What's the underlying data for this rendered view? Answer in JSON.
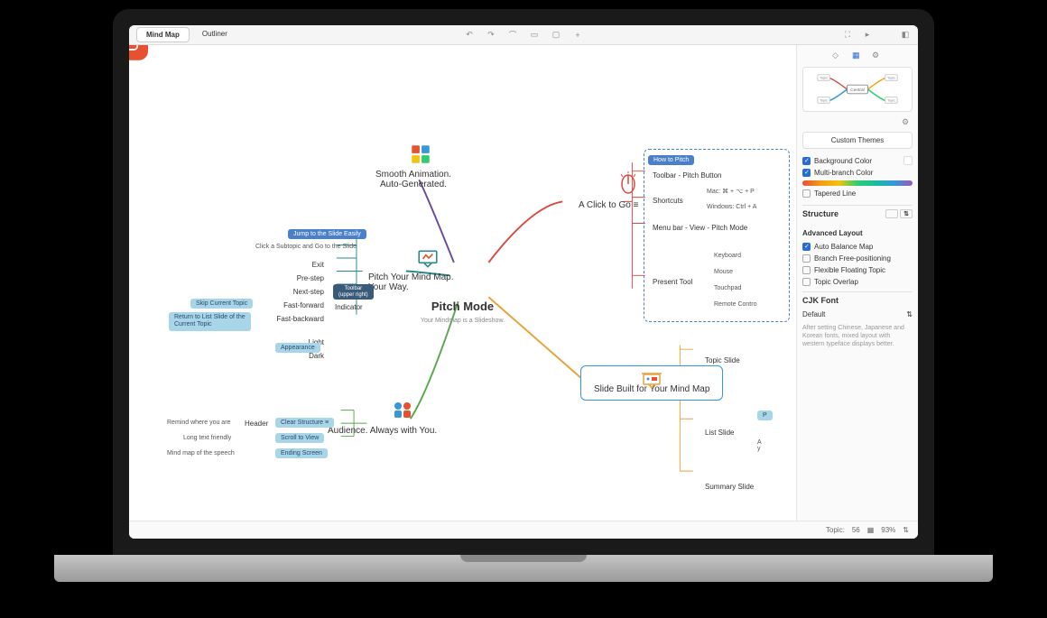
{
  "header": {
    "tabs": [
      "Mind Map",
      "Outliner"
    ],
    "active_tab": "Mind Map"
  },
  "central": {
    "title": "Pitch Mode",
    "subtitle": "Your Mindmap is a Slideshow."
  },
  "branch_top_left": {
    "label": "Smooth Animation.\nAuto-Generated."
  },
  "branch_mid_left": {
    "label": "Pitch Your Mind Map.\nYour Way.",
    "pill": "Jump to the Slide Easily",
    "click_sub": "Click a Subtopic and Go to the Slide",
    "items": [
      "Exit",
      "Pre-step",
      "Next-step",
      "Fast-forward",
      "Fast-backward",
      "Light",
      "Dark"
    ],
    "indicator_label": "Indicator",
    "indicator_tooltip": "Toolbar\n(upper right)",
    "sub_pills": [
      "Skip Current Topic",
      "Return to List Slide of the\nCurrent Topic",
      "Appearance"
    ]
  },
  "branch_bot_left": {
    "label": "Audience. Always with You.",
    "rows": [
      {
        "left": "Remind where you are",
        "mid": "Header",
        "right": "Clear Structure"
      },
      {
        "left": "Long text friendly",
        "mid": "",
        "right": "Scroll to View"
      },
      {
        "left": "Mind map of the speech",
        "mid": "",
        "right": "Ending Screen"
      }
    ]
  },
  "branch_top_right": {
    "label": "A Click to Go",
    "pill": "How to Pitch",
    "rows": [
      {
        "label": "Toolbar - Pitch Button"
      },
      {
        "label": "Shortcuts",
        "children": [
          "Mac: ⌘ + ⌥ + P",
          "Windows: Ctrl + A"
        ]
      },
      {
        "label": "Menu bar - View - Pitch Mode"
      },
      {
        "label": "Present Tool",
        "children": [
          "Keyboard",
          "Mouse",
          "Touchpad",
          "Remote Contro"
        ]
      }
    ]
  },
  "branch_bot_right": {
    "label": "Slide Built for Your Mind Map",
    "rows": [
      {
        "label": "Topic Slide"
      },
      {
        "label": "List Slide",
        "children": [
          "P",
          "A\ny"
        ]
      },
      {
        "label": "Summary Slide"
      }
    ]
  },
  "sidebar": {
    "custom_themes": "Custom Themes",
    "background_color": "Background Color",
    "multibranch_color": "Multi-branch Color",
    "tapered_line": "Tapered Line",
    "structure": "Structure",
    "advanced_layout": "Advanced Layout",
    "auto_balance": "Auto Balance Map",
    "branch_free": "Branch Free-positioning",
    "flexible_floating": "Flexible Floating Topic",
    "topic_overlap": "Topic Overlap",
    "cjk_font_label": "CJK Font",
    "cjk_font_value": "Default",
    "cjk_footnote": "After setting Chinese, Japanese and Korean fonts, mixed layout with western typeface displays better.",
    "preview_labels": {
      "center": "Central",
      "topic": "Topic"
    }
  },
  "status": {
    "topic_count_label": "Topic:",
    "topic_count": "56",
    "zoom": "93%"
  }
}
